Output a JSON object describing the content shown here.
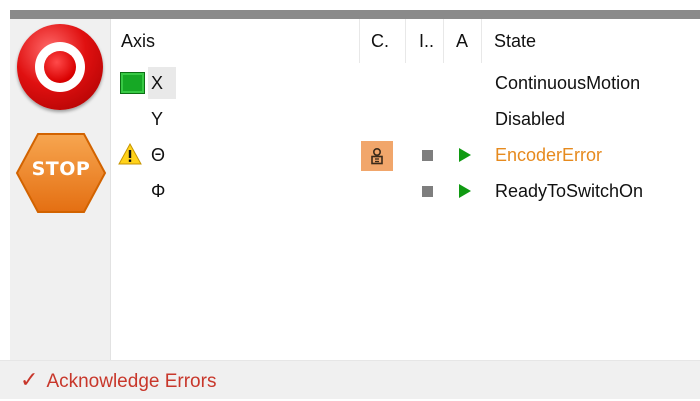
{
  "header": {
    "axis": "Axis",
    "c": "C.",
    "i": "I..",
    "a": "A",
    "state": "State"
  },
  "axes": [
    {
      "name": "X",
      "state": "ContinuousMotion",
      "indicator": "green-square-icon",
      "selected": true
    },
    {
      "name": "Y",
      "state": "Disabled"
    },
    {
      "name": "Θ",
      "state": "EncoderError",
      "indicator": "warning-triangle-icon",
      "c_icon": "person-lock-icon",
      "i_icon": "stop-square-icon",
      "a_icon": "play-triangle-icon",
      "state_color": "#e68a1e"
    },
    {
      "name": "Φ",
      "state": "ReadyToSwitchOn",
      "i_icon": "stop-square-icon",
      "a_icon": "play-triangle-icon"
    }
  ],
  "left_panel": {
    "emergency_icon": "emergency-stop-button-icon",
    "stop_button": "STOP"
  },
  "footer": {
    "acknowledge_label": "Acknowledge Errors",
    "acknowledge_icon": "check-icon"
  },
  "colors": {
    "warning": "#e68a1e",
    "accent_red": "#c8372b",
    "ok_green": "#16a825"
  }
}
